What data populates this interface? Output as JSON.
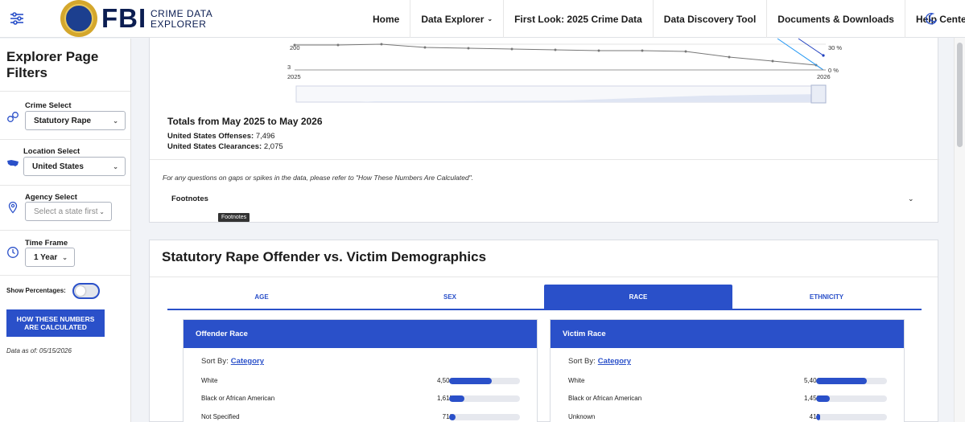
{
  "header": {
    "brand_word": "FBI",
    "brand_line1": "CRIME DATA",
    "brand_line2": "EXPLORER",
    "nav": [
      {
        "label": "Home",
        "dropdown": false
      },
      {
        "label": "Data Explorer",
        "dropdown": true
      },
      {
        "label": "First Look: 2025 Crime Data",
        "dropdown": false
      },
      {
        "label": "Data Discovery Tool",
        "dropdown": false
      },
      {
        "label": "Documents & Downloads",
        "dropdown": false
      },
      {
        "label": "Help Center",
        "dropdown": false
      }
    ]
  },
  "sidebar": {
    "title_line1": "Explorer Page",
    "title_line2": "Filters",
    "crime": {
      "label": "Crime Select",
      "value": "Statutory Rape",
      "icon": "handcuffs-icon"
    },
    "location": {
      "label": "Location Select",
      "value": "United States",
      "icon": "us-map-icon"
    },
    "agency": {
      "label": "Agency Select",
      "placeholder": "Select a state first",
      "icon": "location-pin-icon"
    },
    "timeframe": {
      "label": "Time Frame",
      "value": "1 Year",
      "icon": "clock-icon"
    },
    "show_percentages": {
      "label": "Show Percentages:",
      "on": false
    },
    "how_button_line1": "HOW THESE NUMBERS",
    "how_button_line2": "ARE CALCULATED",
    "data_as_of": "Data as of: 05/15/2026"
  },
  "trend": {
    "y_tick_top": "200",
    "y_tick_bottom": "3",
    "x_start": "2025",
    "x_end": "2026",
    "right_tick_top": "30 %",
    "right_tick_bottom": "0 %",
    "totals_title": "Totals from May 2025 to May 2026",
    "offenses_label": "United States Offenses:",
    "offenses_value": "7,496",
    "clearances_label": "United States Clearances:",
    "clearances_value": "2,075",
    "note": "For any questions on gaps or spikes in the data, please refer to \"How These Numbers Are Calculated\".",
    "footnotes_label": "Footnotes",
    "tooltip": "Footnotes",
    "colors": {
      "line": "#777777",
      "accent": "#2196f3",
      "navy": "#1f3fbf"
    }
  },
  "demographics": {
    "title": "Statutory Rape Offender vs. Victim Demographics",
    "tabs": [
      {
        "label": "AGE",
        "active": false
      },
      {
        "label": "SEX",
        "active": false
      },
      {
        "label": "RACE",
        "active": true
      },
      {
        "label": "ETHNICITY",
        "active": false
      }
    ],
    "sort_label": "Sort By:",
    "sort_value": "Category",
    "offender": {
      "title": "Offender Race",
      "rows": [
        {
          "label": "White",
          "value": "4,501",
          "fraction": 0.6
        },
        {
          "label": "Black or African American",
          "value": "1,615",
          "fraction": 0.215
        },
        {
          "label": "Not Specified",
          "value": "712",
          "fraction": 0.095
        }
      ]
    },
    "victim": {
      "title": "Victim Race",
      "rows": [
        {
          "label": "White",
          "value": "5,401",
          "fraction": 0.72
        },
        {
          "label": "Black or African American",
          "value": "1,452",
          "fraction": 0.194
        },
        {
          "label": "Unknown",
          "value": "417",
          "fraction": 0.056
        }
      ]
    }
  },
  "theme": {
    "primary": "#2a50c9",
    "brand_navy": "#0b1d51"
  }
}
